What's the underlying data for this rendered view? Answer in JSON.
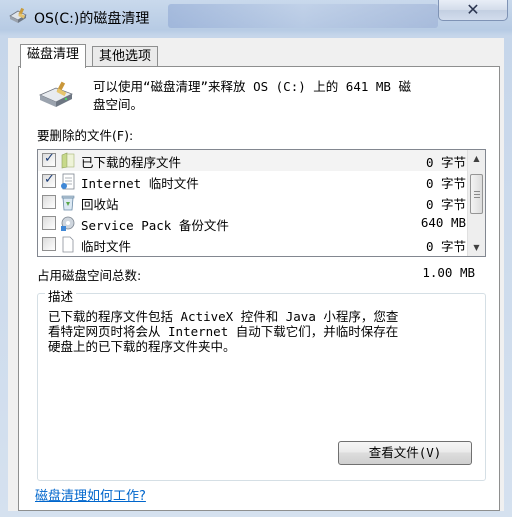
{
  "window": {
    "title": "OS(C:)的磁盘清理",
    "close_label": "✕"
  },
  "tabs": [
    {
      "label": "磁盘清理",
      "active": true
    },
    {
      "label": "其他选项",
      "active": false
    }
  ],
  "intro": {
    "line1": "可以使用“磁盘清理”来释放 OS (C:) 上的 641 MB 磁",
    "line2": "盘空间。"
  },
  "list_label": "要删除的文件(F):",
  "files": [
    {
      "name": "已下载的程序文件",
      "size": "0 字节",
      "checked": true,
      "icon": "folder-icon"
    },
    {
      "name": "Internet 临时文件",
      "size": "0 字节",
      "checked": true,
      "icon": "internet-file-icon"
    },
    {
      "name": "回收站",
      "size": "0 字节",
      "checked": false,
      "icon": "recycle-bin-icon"
    },
    {
      "name": "Service Pack 备份文件",
      "size": "640 MB",
      "checked": false,
      "icon": "service-pack-icon"
    },
    {
      "name": "临时文件",
      "size": "0 字节",
      "checked": false,
      "icon": "blank-file-icon"
    }
  ],
  "total": {
    "label": "占用磁盘空间总数:",
    "value": "1.00 MB"
  },
  "description": {
    "legend": "描述",
    "line1": "已下载的程序文件包括 ActiveX 控件和 Java 小程序，您查",
    "line2": "看特定网页时将会从 Internet 自动下载它们，并临时保存在",
    "line3": "硬盘上的已下载的程序文件夹中。"
  },
  "view_files_label": "查看文件(V)",
  "help_link": "磁盘清理如何工作?"
}
